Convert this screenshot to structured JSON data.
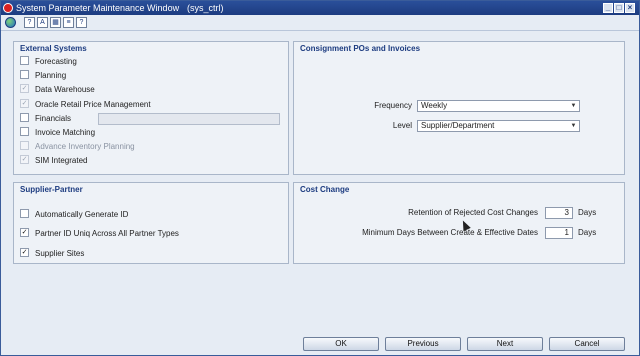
{
  "window": {
    "title": "System Parameter Maintenance Window",
    "subtitle": "(sys_ctrl)",
    "buttons": [
      "minimize",
      "maximize",
      "close"
    ]
  },
  "toolbar": {
    "icons": [
      "globe-icon",
      "help-icon",
      "spell-icon",
      "calendar-icon",
      "doc-icon",
      "question-icon"
    ],
    "glyphs": [
      "",
      "?",
      "A",
      "▦",
      "≡",
      "?"
    ]
  },
  "external_systems": {
    "title": "External Systems",
    "items": [
      {
        "label": "Forecasting",
        "checked": false,
        "disabled": false
      },
      {
        "label": "Planning",
        "checked": false,
        "disabled": false
      },
      {
        "label": "Data Warehouse",
        "checked": true,
        "disabled": false
      },
      {
        "label": "Oracle Retail Price Management",
        "checked": true,
        "disabled": false
      },
      {
        "label": "Financials",
        "checked": false,
        "disabled": false
      },
      {
        "label": "Invoice Matching",
        "checked": false,
        "disabled": false
      },
      {
        "label": "Advance Inventory Planning",
        "checked": false,
        "disabled": true
      },
      {
        "label": "SIM Integrated",
        "checked": true,
        "disabled": false
      }
    ],
    "financials_field_value": ""
  },
  "consignment": {
    "title": "Consignment POs and Invoices",
    "frequency_label": "Frequency",
    "frequency_value": "Weekly",
    "level_label": "Level",
    "level_value": "Supplier/Department"
  },
  "supplier_partner": {
    "title": "Supplier-Partner",
    "items": [
      {
        "label": "Automatically Generate ID",
        "checked": false
      },
      {
        "label": "Partner ID Uniq Across All Partner Types",
        "checked": true
      },
      {
        "label": "Supplier Sites",
        "checked": true
      }
    ]
  },
  "cost_change": {
    "title": "Cost Change",
    "retention_label": "Retention of Rejected Cost Changes",
    "retention_value": "3",
    "retention_unit": "Days",
    "min_days_label": "Minimum Days Between Create & Effective Dates",
    "min_days_value": "1",
    "min_days_unit": "Days"
  },
  "footer": {
    "ok": "OK",
    "previous": "Previous",
    "next": "Next",
    "cancel": "Cancel"
  },
  "colors": {
    "title_bar": "#1d3c80",
    "panel_title": "#1d3c80",
    "background": "#e6ecf4"
  }
}
